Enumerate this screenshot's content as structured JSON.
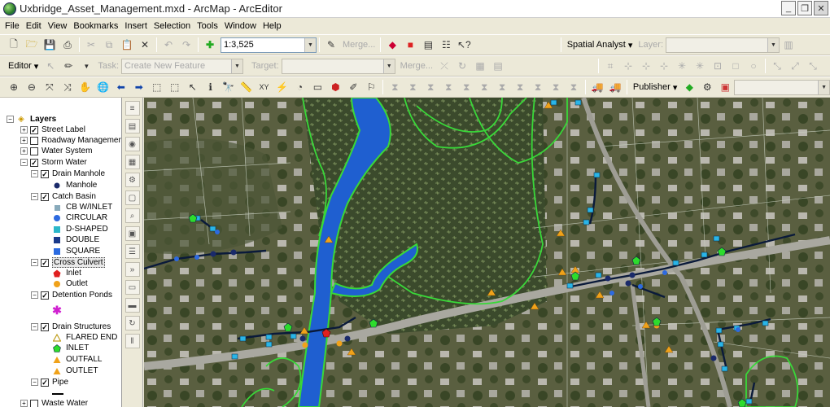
{
  "window": {
    "title": "Uxbridge_Asset_Management.mxd - ArcMap - ArcEditor"
  },
  "menu": [
    "File",
    "Edit",
    "View",
    "Bookmarks",
    "Insert",
    "Selection",
    "Tools",
    "Window",
    "Help"
  ],
  "toolbar": {
    "scale": "1:3,525",
    "merge1": "Merge...",
    "spatial_analyst": "Spatial Analyst",
    "layer_label": "Layer:",
    "editor": "Editor",
    "task_label": "Task:",
    "task_value": "Create New Feature",
    "target_label": "Target:",
    "merge2": "Merge...",
    "publisher": "Publisher"
  },
  "toc": {
    "layers_title": "Layers",
    "items": [
      "Street Label",
      "Roadway Management",
      "Water System",
      "Storm Water",
      "Drain Manhole",
      "Manhole",
      "Catch Basin",
      "CB W/INLET",
      "CIRCULAR",
      "D-SHAPED",
      "DOUBLE",
      "SQUARE",
      "Cross Culvert",
      "Inlet",
      "Outlet",
      "Detention Ponds",
      "Drain Structures",
      "FLARED END",
      "INLET",
      "OUTFALL",
      "OUTLET",
      "Pipe",
      "Waste Water"
    ]
  },
  "colors": {
    "river": "#1f5fd0",
    "boundary": "#39d839",
    "parcel": "#c8d0c0",
    "pipe": "#0a1a3a",
    "catch_basin": "#29b5e8",
    "outfall": "#f0a21a",
    "inlet": "#2ddc2d",
    "culvert": "#e02020"
  }
}
